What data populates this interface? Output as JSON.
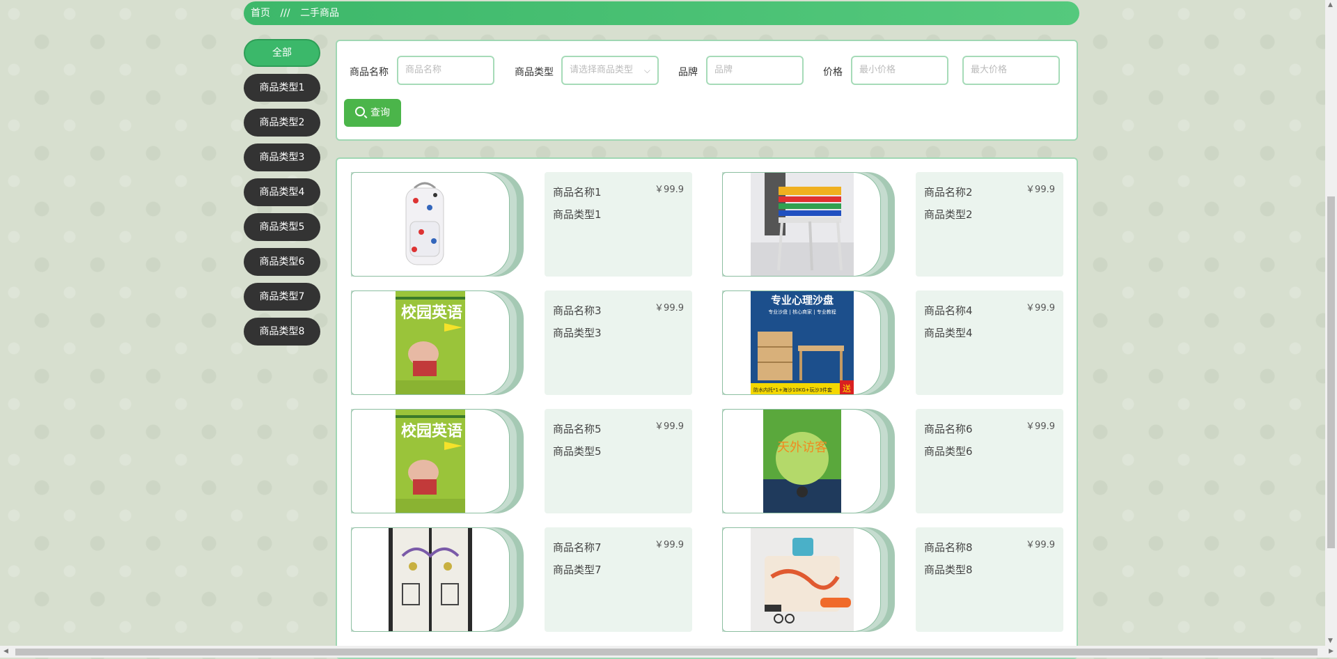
{
  "breadcrumb": {
    "home": "首页",
    "separator": "///",
    "current": "二手商品"
  },
  "sidebar": {
    "items": [
      {
        "label": "全部"
      },
      {
        "label": "商品类型1"
      },
      {
        "label": "商品类型2"
      },
      {
        "label": "商品类型3"
      },
      {
        "label": "商品类型4"
      },
      {
        "label": "商品类型5"
      },
      {
        "label": "商品类型6"
      },
      {
        "label": "商品类型7"
      },
      {
        "label": "商品类型8"
      }
    ]
  },
  "search": {
    "name_label": "商品名称",
    "name_placeholder": "商品名称",
    "type_label": "商品类型",
    "type_placeholder": "请选择商品类型",
    "brand_label": "品牌",
    "brand_placeholder": "品牌",
    "price_label": "价格",
    "min_price_placeholder": "最小价格",
    "max_price_placeholder": "最大价格",
    "button_label": "查询"
  },
  "products": [
    {
      "name": "商品名称1",
      "type": "商品类型1",
      "price": "￥99.9",
      "image": "backpack"
    },
    {
      "name": "商品名称2",
      "type": "商品类型2",
      "price": "￥99.9",
      "image": "chairs"
    },
    {
      "name": "商品名称3",
      "type": "商品类型3",
      "price": "￥99.9",
      "image": "book-english"
    },
    {
      "name": "商品名称4",
      "type": "商品类型4",
      "price": "￥99.9",
      "image": "sand-tray"
    },
    {
      "name": "商品名称5",
      "type": "商品类型5",
      "price": "￥99.9",
      "image": "book-english"
    },
    {
      "name": "商品名称6",
      "type": "商品类型6",
      "price": "￥99.9",
      "image": "book-visitor"
    },
    {
      "name": "商品名称7",
      "type": "商品类型7",
      "price": "￥99.9",
      "image": "curtain"
    },
    {
      "name": "商品名称8",
      "type": "商品类型8",
      "price": "￥99.9",
      "image": "bag"
    }
  ],
  "image_text": {
    "book_english_title": "校园英语",
    "sand_tray_title": "专业心理沙盘",
    "sand_tray_sub": "专业沙盘 | 核心商家 | 专业教程",
    "sand_tray_footer": "防水内托*1+海沙10KG+玩沙3件套",
    "sand_tray_badge": "送",
    "book_visitor_title": "天外访客"
  },
  "colors": {
    "accent": "#3db86a",
    "dark_button": "#333333",
    "search_button": "#4bb54a",
    "card_bg": "#ebf4ee"
  }
}
